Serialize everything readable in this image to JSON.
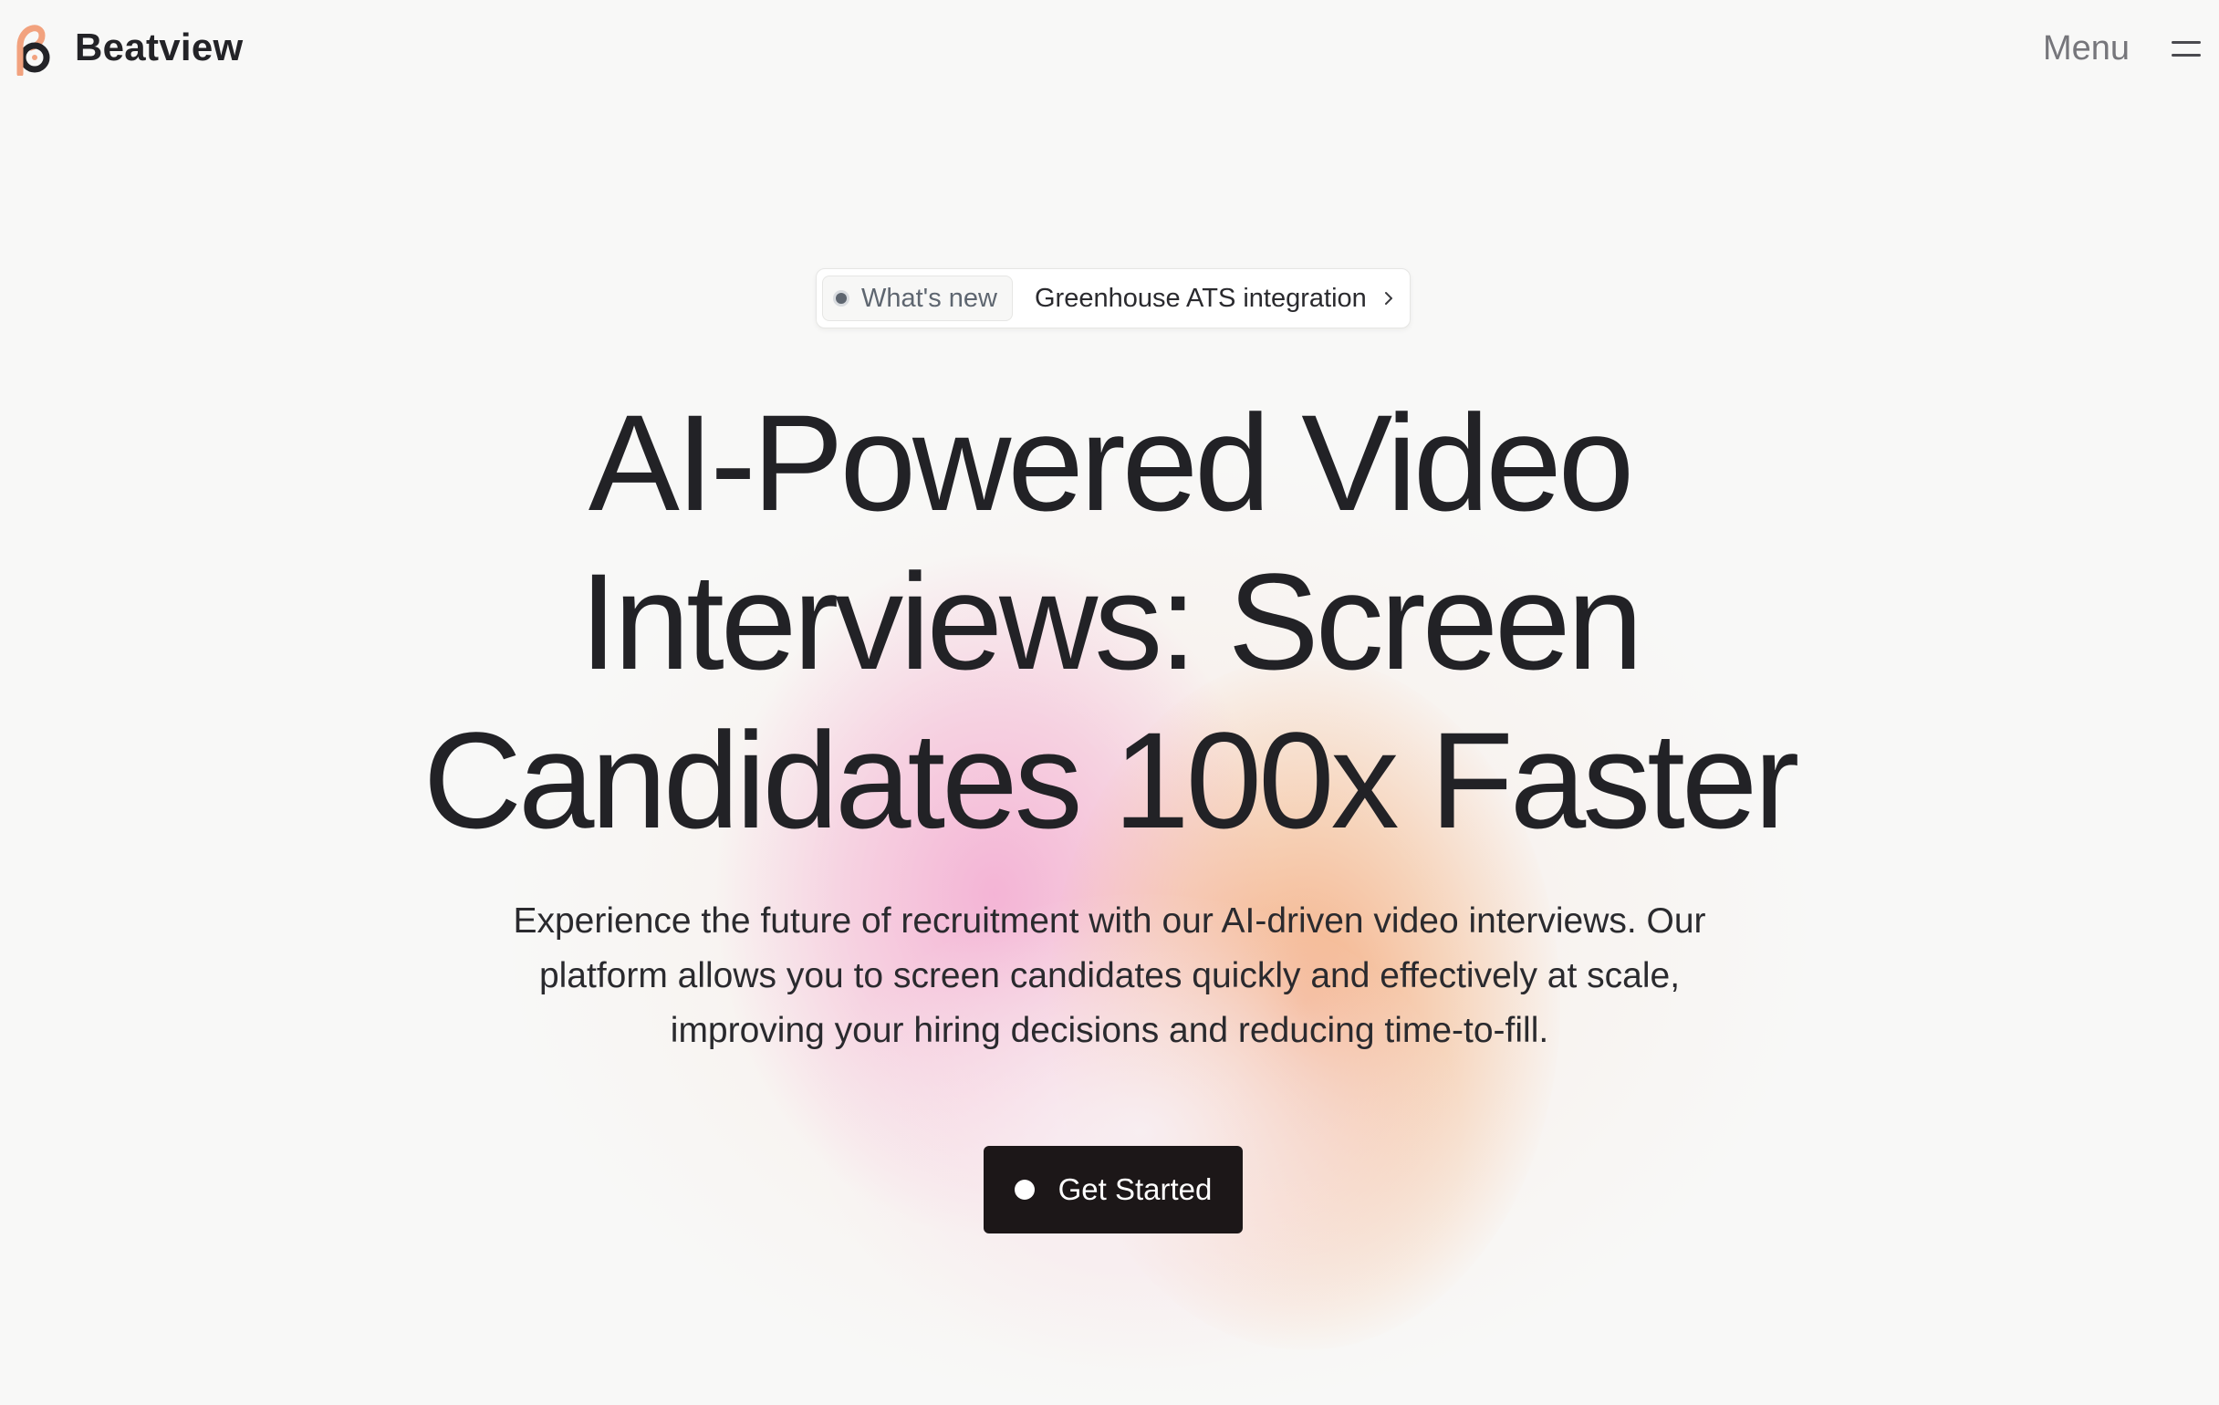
{
  "header": {
    "brand_name": "Beatview",
    "menu_label": "Menu",
    "logo_colors": {
      "peach": "#f2a27e",
      "dark": "#232327"
    }
  },
  "announcement": {
    "tag_label": "What's new",
    "text": "Greenhouse ATS integration",
    "icon": "chevron-right-icon"
  },
  "hero": {
    "title_line1": "AI-Powered Video",
    "title_line2": "Interviews: Screen",
    "title_line3": "Candidates 100x Faster",
    "subtitle_line1": "Experience the future of recruitment with our AI-driven video interviews. Our",
    "subtitle_line2": "platform allows you to screen candidates quickly and effectively at scale,",
    "subtitle_line3": "improving your hiring decisions and reducing time-to-fill.",
    "cta_label": "Get Started"
  },
  "colors": {
    "background": "#f8f8f7",
    "text": "#222226",
    "cta_background": "#1c1718",
    "glow_pink": "#f3aad2",
    "glow_orange": "#f3a06e"
  }
}
